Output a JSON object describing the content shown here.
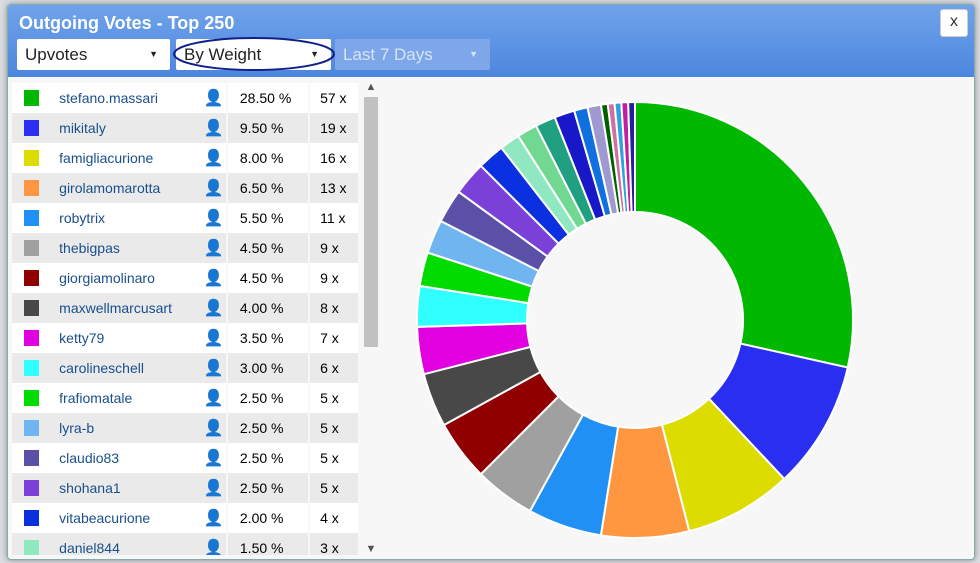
{
  "title": "Outgoing Votes - Top 250",
  "close_label": "x",
  "filters": {
    "type": "Upvotes",
    "sort": "By Weight",
    "period": "Last 7 Days"
  },
  "rows": [
    {
      "name": "stefano.massari",
      "pct": "28.50 %",
      "count": "57 x",
      "color": "#00b800"
    },
    {
      "name": "mikitaly",
      "pct": "9.50 %",
      "count": "19 x",
      "color": "#2a2ef0"
    },
    {
      "name": "famigliacurione",
      "pct": "8.00 %",
      "count": "16 x",
      "color": "#dcdc00"
    },
    {
      "name": "girolamomarotta",
      "pct": "6.50 %",
      "count": "13 x",
      "color": "#ff9640"
    },
    {
      "name": "robytrix",
      "pct": "5.50 %",
      "count": "11 x",
      "color": "#2090f5"
    },
    {
      "name": "thebigpas",
      "pct": "4.50 %",
      "count": "9 x",
      "color": "#a0a0a0"
    },
    {
      "name": "giorgiamolinaro",
      "pct": "4.50 %",
      "count": "9 x",
      "color": "#900000"
    },
    {
      "name": "maxwellmarcusart",
      "pct": "4.00 %",
      "count": "8 x",
      "color": "#484848"
    },
    {
      "name": "ketty79",
      "pct": "3.50 %",
      "count": "7 x",
      "color": "#e000e0"
    },
    {
      "name": "carolineschell",
      "pct": "3.00 %",
      "count": "6 x",
      "color": "#30ffff"
    },
    {
      "name": "frafiomatale",
      "pct": "2.50 %",
      "count": "5 x",
      "color": "#00dc00"
    },
    {
      "name": "lyra-b",
      "pct": "2.50 %",
      "count": "5 x",
      "color": "#70b4f0"
    },
    {
      "name": "claudio83",
      "pct": "2.50 %",
      "count": "5 x",
      "color": "#5a50a8"
    },
    {
      "name": "shohana1",
      "pct": "2.50 %",
      "count": "5 x",
      "color": "#7a40d8"
    },
    {
      "name": "vitabeacurione",
      "pct": "2.00 %",
      "count": "4 x",
      "color": "#0a30e0"
    },
    {
      "name": "daniel844",
      "pct": "1.50 %",
      "count": "3 x",
      "color": "#90e8c0"
    }
  ],
  "chart_data": {
    "type": "pie",
    "donut": true,
    "values": [
      28.5,
      9.5,
      8,
      6.5,
      5.5,
      4.5,
      4.5,
      4,
      3.5,
      3,
      2.5,
      2.5,
      2.5,
      2.5,
      2,
      1.5,
      1.5,
      1.5,
      1.5,
      1,
      1,
      0.5,
      0.5,
      0.5,
      0.5,
      0.5
    ],
    "colors": [
      "#00b800",
      "#2a2ef0",
      "#dcdc00",
      "#ff9640",
      "#2090f5",
      "#a0a0a0",
      "#900000",
      "#484848",
      "#e000e0",
      "#30ffff",
      "#00dc00",
      "#70b4f0",
      "#5a50a8",
      "#7a40d8",
      "#0a30e0",
      "#90e8c0",
      "#70d890",
      "#20a080",
      "#1818c8",
      "#1070e0",
      "#a098d0",
      "#006000",
      "#d070a0",
      "#30a0e0",
      "#c020a0",
      "#2020a0"
    ]
  }
}
